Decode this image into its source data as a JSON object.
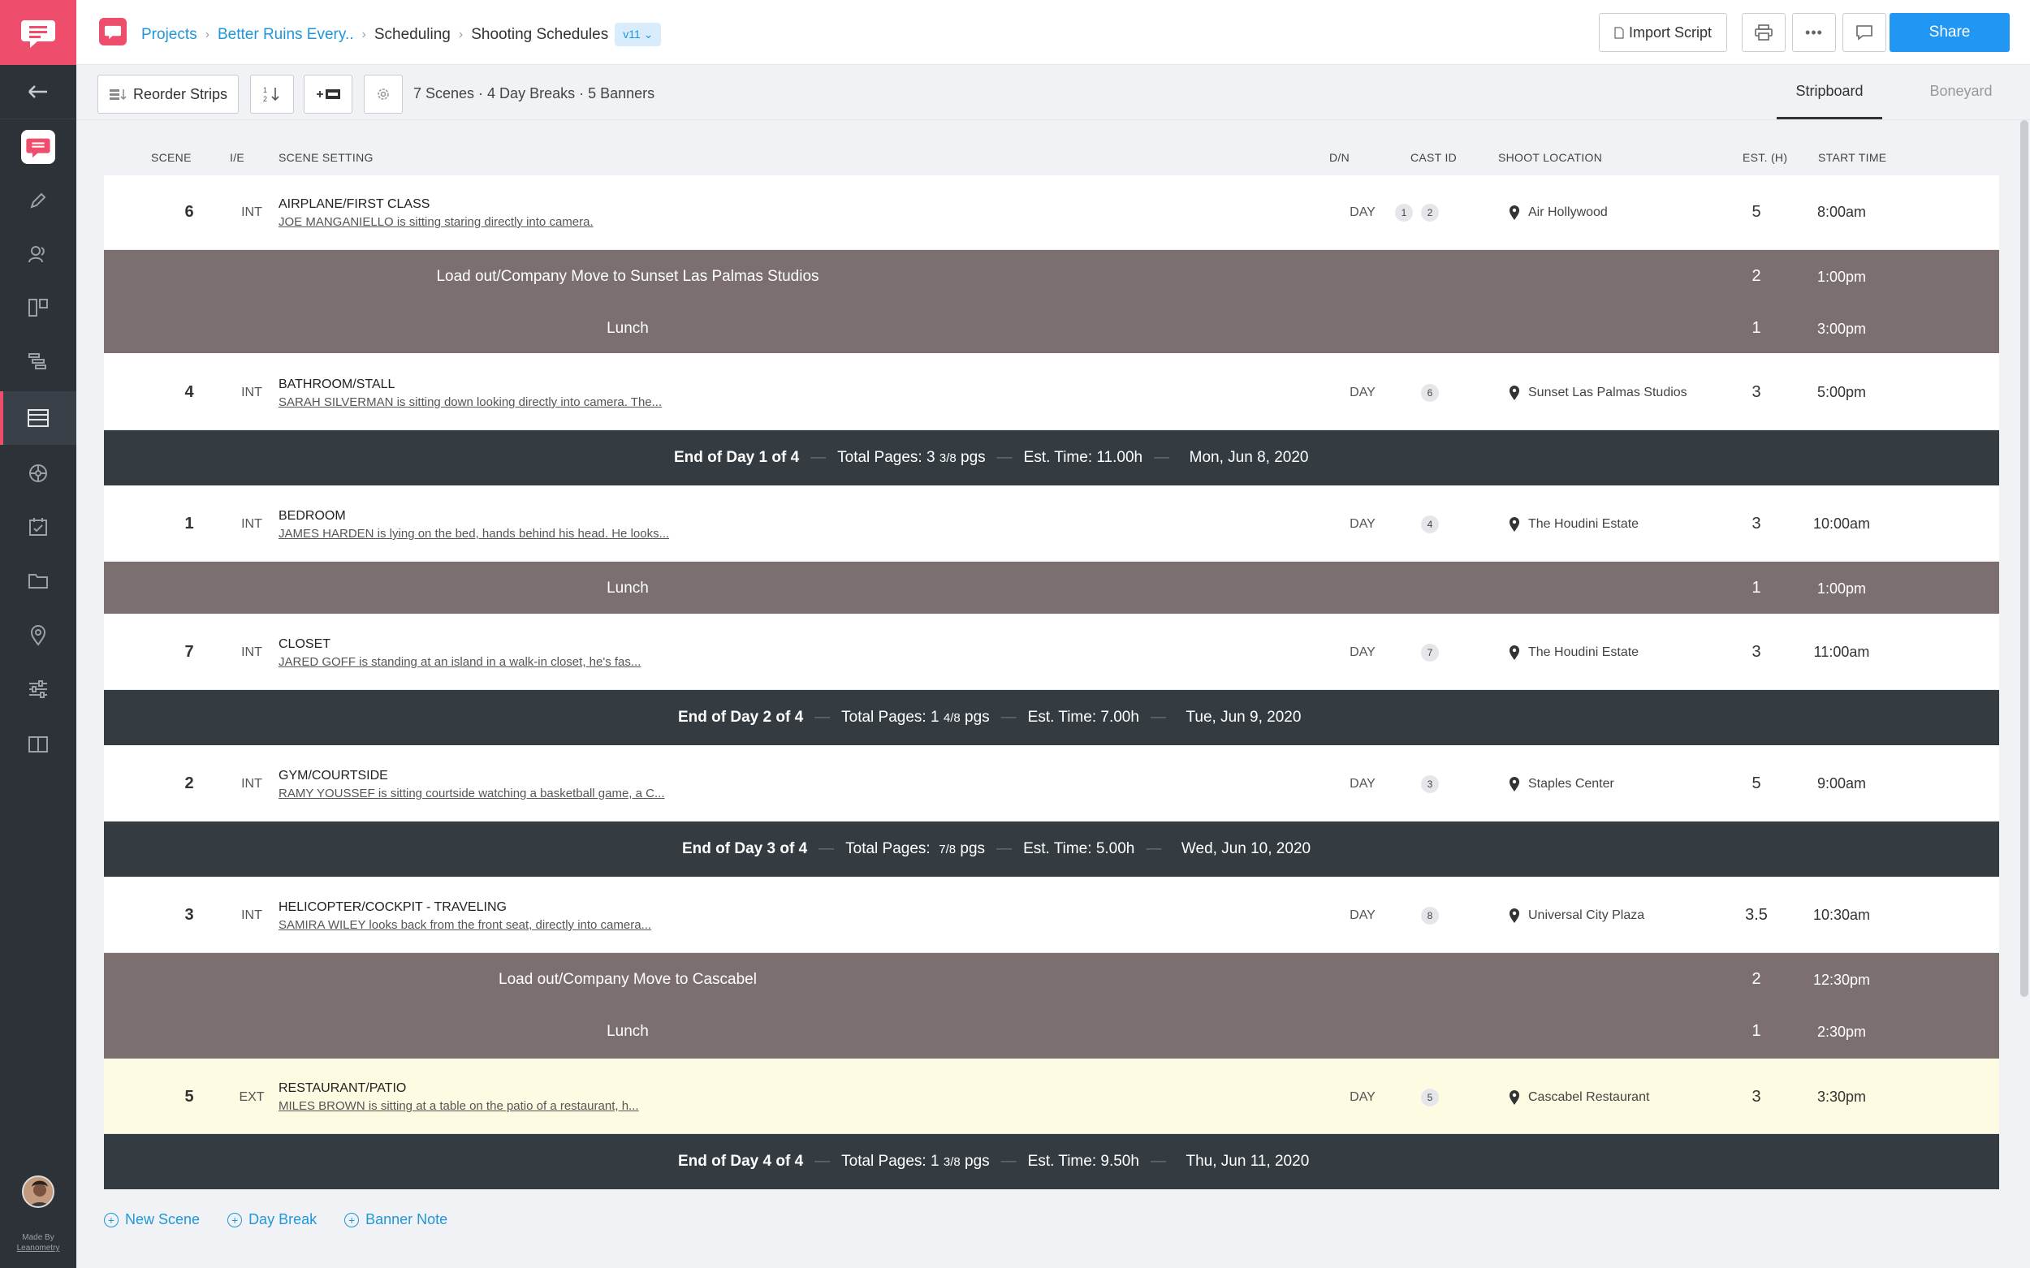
{
  "sidebar": {
    "made_by": "Made By",
    "maker": "Leanometry"
  },
  "header": {
    "breadcrumbs": [
      "Projects",
      "Better Ruins Every..",
      "Scheduling",
      "Shooting Schedules"
    ],
    "version": "v11",
    "import_label": "Import Script",
    "share_label": "Share"
  },
  "toolbar": {
    "reorder_label": "Reorder Strips",
    "sort_label": "1 2",
    "summary": "7 Scenes · 4 Day Breaks · 5 Banners",
    "tabs": [
      "Stripboard",
      "Boneyard"
    ]
  },
  "columns": {
    "scene": "SCENE",
    "ie": "I/E",
    "setting": "SCENE SETTING",
    "dn": "D/N",
    "cast": "CAST ID",
    "location": "SHOOT LOCATION",
    "est": "EST. (H)",
    "start": "START TIME"
  },
  "rows": {
    "r1": {
      "scene": "6",
      "ie": "INT",
      "setting": "AIRPLANE/FIRST CLASS",
      "desc": "JOE MANGANIELLO is sitting staring directly into camera.",
      "dn": "DAY",
      "cast": [
        "1",
        "2"
      ],
      "location": "Air Hollywood",
      "est": "5",
      "start": "8:00am"
    },
    "b1": {
      "text": "Load out/Company Move to Sunset Las Palmas Studios",
      "est": "2",
      "start": "1:00pm"
    },
    "b2": {
      "text": "Lunch",
      "est": "1",
      "start": "3:00pm"
    },
    "r2": {
      "scene": "4",
      "ie": "INT",
      "setting": "BATHROOM/STALL",
      "desc": "SARAH SILVERMAN is sitting down looking directly into camera. The...",
      "dn": "DAY",
      "cast": [
        "6"
      ],
      "location": "Sunset Las Palmas Studios",
      "est": "3",
      "start": "5:00pm"
    },
    "d1": {
      "title": "End of Day 1 of 4",
      "pages_label": "Total Pages:",
      "pages_whole": "3",
      "pages_frac": "3/8",
      "pages_unit": "pgs",
      "time_label": "Est. Time:",
      "time": "11.00h",
      "date": "Mon, Jun 8, 2020"
    },
    "r3": {
      "scene": "1",
      "ie": "INT",
      "setting": "BEDROOM",
      "desc": "JAMES HARDEN is lying on the bed, hands behind his head. He looks...",
      "dn": "DAY",
      "cast": [
        "4"
      ],
      "location": "The Houdini Estate",
      "est": "3",
      "start": "10:00am"
    },
    "b3": {
      "text": "Lunch",
      "est": "1",
      "start": "1:00pm"
    },
    "r4": {
      "scene": "7",
      "ie": "INT",
      "setting": "CLOSET",
      "desc": "JARED GOFF is standing at an island in a walk-in closet, he's fas...",
      "dn": "DAY",
      "cast": [
        "7"
      ],
      "location": "The Houdini Estate",
      "est": "3",
      "start": "11:00am"
    },
    "d2": {
      "title": "End of Day 2 of 4",
      "pages_label": "Total Pages:",
      "pages_whole": "1",
      "pages_frac": "4/8",
      "pages_unit": "pgs",
      "time_label": "Est. Time:",
      "time": "7.00h",
      "date": "Tue, Jun 9, 2020"
    },
    "r5": {
      "scene": "2",
      "ie": "INT",
      "setting": "GYM/COURTSIDE",
      "desc": "RAMY YOUSSEF is sitting courtside watching a basketball game, a C...",
      "dn": "DAY",
      "cast": [
        "3"
      ],
      "location": "Staples Center",
      "est": "5",
      "start": "9:00am"
    },
    "d3": {
      "title": "End of Day 3 of 4",
      "pages_label": "Total Pages:",
      "pages_whole": "",
      "pages_frac": "7/8",
      "pages_unit": "pgs",
      "time_label": "Est. Time:",
      "time": "5.00h",
      "date": "Wed, Jun 10, 2020"
    },
    "r6": {
      "scene": "3",
      "ie": "INT",
      "setting": "HELICOPTER/COCKPIT - TRAVELING",
      "desc": "SAMIRA WILEY looks back from the front seat, directly into camera...",
      "dn": "DAY",
      "cast": [
        "8"
      ],
      "location": "Universal City Plaza",
      "est": "3.5",
      "start": "10:30am"
    },
    "b4": {
      "text": "Load out/Company Move to Cascabel",
      "est": "2",
      "start": "12:30pm"
    },
    "b5": {
      "text": "Lunch",
      "est": "1",
      "start": "2:30pm"
    },
    "r7": {
      "scene": "5",
      "ie": "EXT",
      "setting": "RESTAURANT/PATIO",
      "desc": "MILES BROWN is sitting at a table on the patio of a restaurant, h...",
      "dn": "DAY",
      "cast": [
        "5"
      ],
      "location": "Cascabel Restaurant",
      "est": "3",
      "start": "3:30pm"
    },
    "d4": {
      "title": "End of Day 4 of 4",
      "pages_label": "Total Pages:",
      "pages_whole": "1",
      "pages_frac": "3/8",
      "pages_unit": "pgs",
      "time_label": "Est. Time:",
      "time": "9.50h",
      "date": "Thu, Jun 11, 2020"
    }
  },
  "actions": {
    "new_scene": "New Scene",
    "day_break": "Day Break",
    "banner_note": "Banner Note"
  },
  "colors": {
    "brand": "#ee4d6b",
    "accent": "#2196f3",
    "banner": "#7b6f6f",
    "day_break": "#353c41",
    "highlight_row": "#fdfbe1"
  }
}
